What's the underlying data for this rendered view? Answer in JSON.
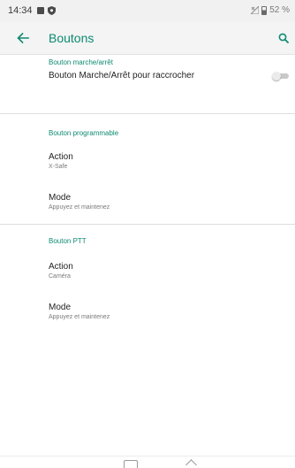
{
  "status_bar": {
    "time": "14:34",
    "battery_percent": "52 %",
    "battery_level": 0.52,
    "icons": [
      "image-icon",
      "shield-icon",
      "signal-icon",
      "battery-icon"
    ]
  },
  "app_bar": {
    "title": "Boutons",
    "back_icon": "arrow-left-icon",
    "search_icon": "search-icon"
  },
  "sections": [
    {
      "header": "Bouton marche/arrêt",
      "items": [
        {
          "title": "Bouton Marche/Arrêt pour raccrocher",
          "toggle": false
        }
      ]
    },
    {
      "header": "Bouton programmable",
      "items": [
        {
          "title": "Action",
          "subtitle": "X-Safe"
        },
        {
          "title": "Mode",
          "subtitle": "Appuyez et maintenez"
        }
      ]
    },
    {
      "header": "Bouton PTT",
      "items": [
        {
          "title": "Action",
          "subtitle": "Caméra"
        },
        {
          "title": "Mode",
          "subtitle": "Appuyez et maintenez"
        }
      ]
    }
  ],
  "colors": {
    "accent": "#0d8a72",
    "status_bar_bg": "#f1f1f1",
    "app_bar_bg": "#f4f4f4",
    "divider": "#dedede"
  },
  "navigation_bar": {
    "icons": [
      "home-icon",
      "back-icon"
    ]
  }
}
